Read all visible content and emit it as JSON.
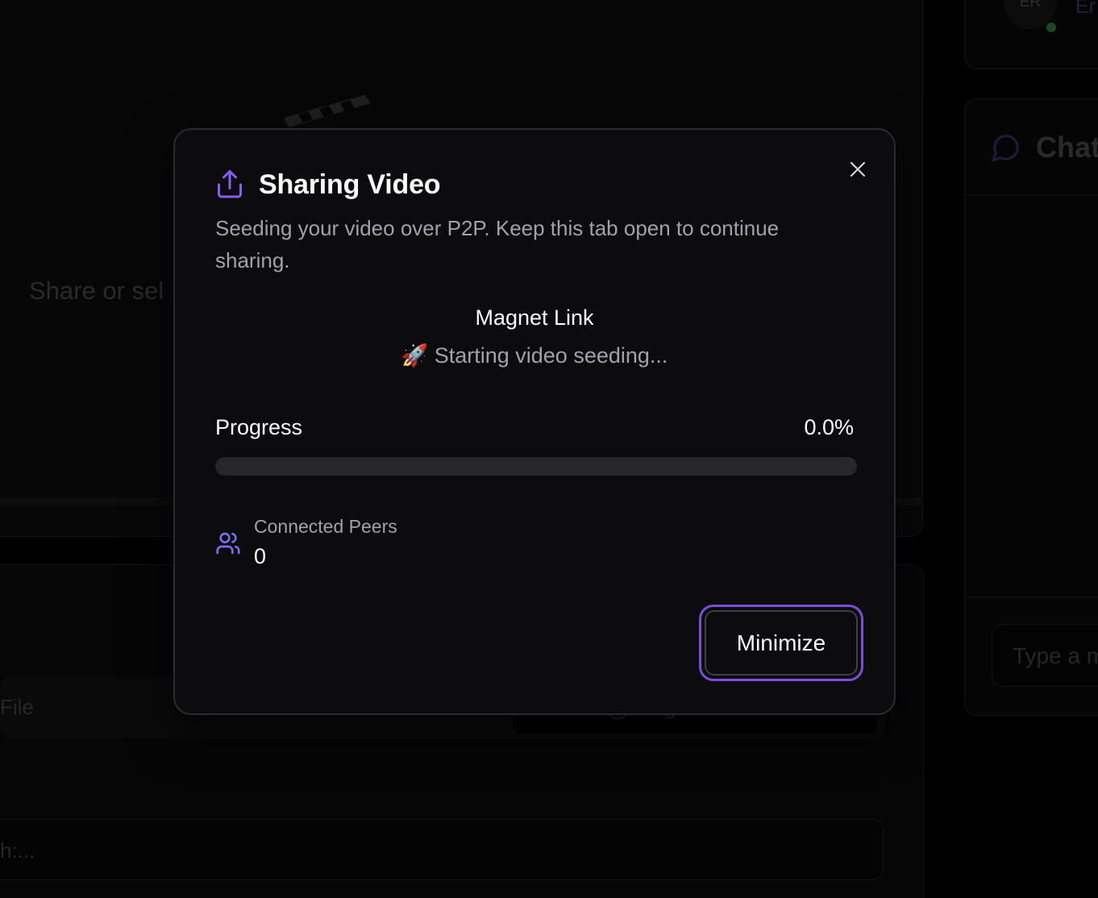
{
  "background": {
    "player_prompt": "Share or sel",
    "tabs": [
      {
        "label": "File"
      },
      {
        "label": "Torrent File"
      },
      {
        "label": "Magnet Link"
      }
    ],
    "input_text": "h:...",
    "user": {
      "initials": "ER",
      "name": "Er"
    },
    "chat": {
      "title": "Chat",
      "placeholder": "Type a m"
    }
  },
  "modal": {
    "title": "Sharing Video",
    "title_icon": "share-upload-icon",
    "description": "Seeding your video over P2P. Keep this tab open to continue sharing.",
    "magnet_label": "Magnet Link",
    "status_text": "🚀 Starting video seeding...",
    "progress": {
      "label": "Progress",
      "value_text": "0.0%",
      "fraction": 0.0
    },
    "peers": {
      "label": "Connected Peers",
      "count": "0",
      "icon": "users-icon"
    },
    "minimize_label": "Minimize",
    "close_icon": "close-icon"
  },
  "colors": {
    "accent": "#8b5cf6",
    "focus_ring": "#7c4ddb",
    "modal_bg": "#0c0c0e",
    "muted_text": "#a1a1aa",
    "progress_track": "#27272a"
  }
}
